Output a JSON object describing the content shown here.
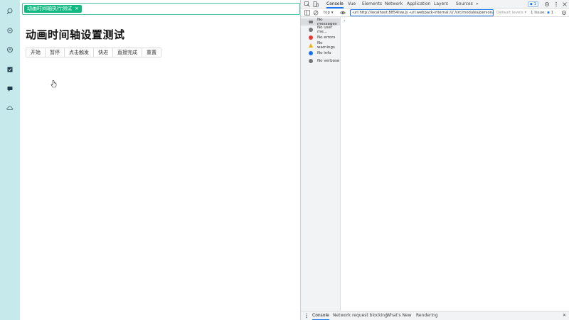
{
  "tag": {
    "label": "动画时间轴执行测试",
    "close": "×"
  },
  "page": {
    "title": "动画时间轴设置测试"
  },
  "buttons": [
    "开始",
    "暂停",
    "点击触发",
    "快进",
    "直接完成",
    "重置"
  ],
  "devtools": {
    "tabs": [
      "Console",
      "Vue",
      "Elements",
      "Network",
      "Application",
      "Layers",
      "Sources"
    ],
    "more": "»",
    "message_badge": "1",
    "context": "top",
    "filter_value": "-url:http://localhost:8854/sw.js -url:webpack-internal:///./src/modules/person/pn",
    "levels": "Default levels",
    "issues": "1 Issue:",
    "issues_count": "1",
    "prompt": "›",
    "sidebar": [
      {
        "label": "No messages",
        "color": "#777777"
      },
      {
        "label": "No user me...",
        "color": "#777777"
      },
      {
        "label": "No errors",
        "color": "#e53935"
      },
      {
        "label": "No warnings",
        "color": "#f4b400"
      },
      {
        "label": "No info",
        "color": "#1a73e8"
      },
      {
        "label": "No verbose",
        "color": "#777777"
      }
    ],
    "drawer_tabs": [
      "Console",
      "Network request blocking",
      "What's New",
      "Rendering"
    ],
    "drawer_close": "✕"
  },
  "colors": {
    "rail": "#c6e9ec",
    "tag": "#10b981",
    "accent": "#1a73e8"
  }
}
